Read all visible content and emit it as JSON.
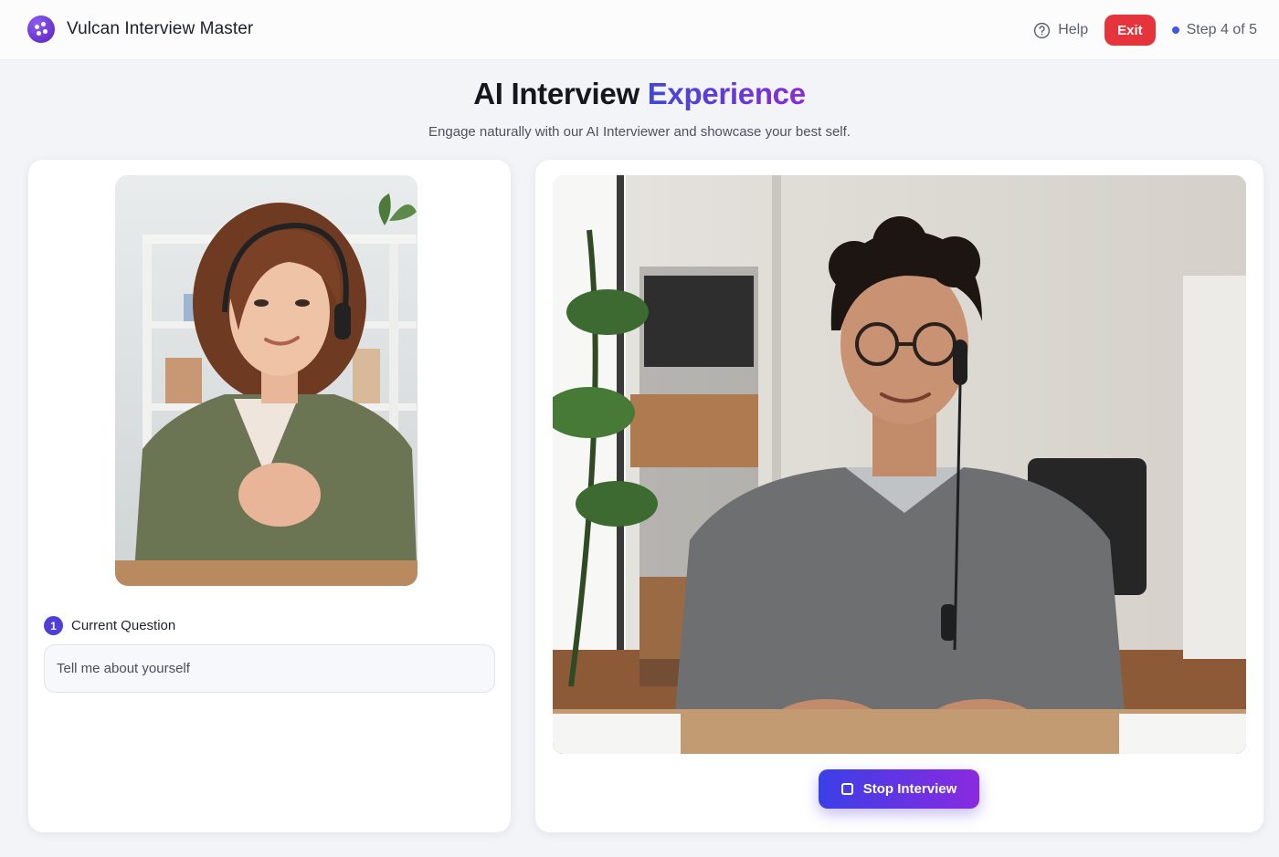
{
  "app": {
    "title": "Vulcan Interview Master",
    "logo_icon": "sparkle-dots-icon"
  },
  "header": {
    "help_label": "Help",
    "help_icon": "question-circle-icon",
    "exit_label": "Exit",
    "step_label": "Step 4 of 5"
  },
  "hero": {
    "title_part1": "AI Interview",
    "title_part2": "Experience",
    "subtitle": "Engage naturally with our AI Interviewer and showcase your best self."
  },
  "question": {
    "number": "1",
    "label": "Current Question",
    "text": "Tell me about yourself"
  },
  "controls": {
    "stop_label": "Stop Interview",
    "stop_icon": "stop-square-icon"
  },
  "colors": {
    "accent_start": "#3b3fe6",
    "accent_end": "#8a2ae0",
    "exit_red": "#e5343b",
    "step_dot": "#4257e8"
  }
}
